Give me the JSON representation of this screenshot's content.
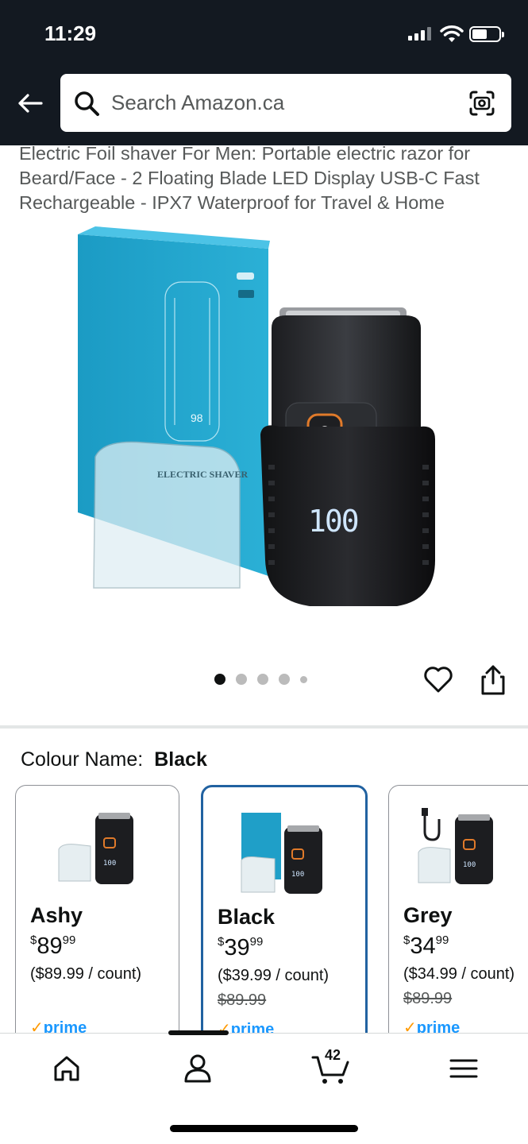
{
  "status_bar": {
    "time": "11:29"
  },
  "header": {
    "search_placeholder": "Search Amazon.ca"
  },
  "product": {
    "title": "Electric Foil shaver For Men: Portable electric razor for Beard/Face - 2 Floating Blade LED Display USB-C Fast Rechargeable - IPX7 Waterproof for Travel & Home",
    "image_texts": {
      "box_label": "ELECTRIC SHAVER",
      "box_number": "98",
      "display": "100"
    },
    "image_count": 5,
    "active_image": 1
  },
  "colour": {
    "label": "Colour Name:",
    "selected": "Black"
  },
  "swatches": [
    {
      "name": "Ashy",
      "price_currency": "$",
      "price_whole": "89",
      "price_frac": "99",
      "unit": "($89.99 / count)",
      "was": "",
      "prime_check": "✓",
      "prime": "prime"
    },
    {
      "name": "Black",
      "price_currency": "$",
      "price_whole": "39",
      "price_frac": "99",
      "unit": "($39.99 / count)",
      "was": "$89.99",
      "prime_check": "✓",
      "prime": "prime"
    },
    {
      "name": "Grey",
      "price_currency": "$",
      "price_whole": "34",
      "price_frac": "99",
      "unit": "($34.99 / count)",
      "was": "$89.99",
      "prime_check": "✓",
      "prime": "prime"
    }
  ],
  "bottom_nav": {
    "cart_count": "42"
  },
  "colors": {
    "header_bg": "#131921",
    "accent_blue": "#2162a1",
    "prime_blue": "#1a98ff",
    "prime_orange": "#ff9900"
  }
}
